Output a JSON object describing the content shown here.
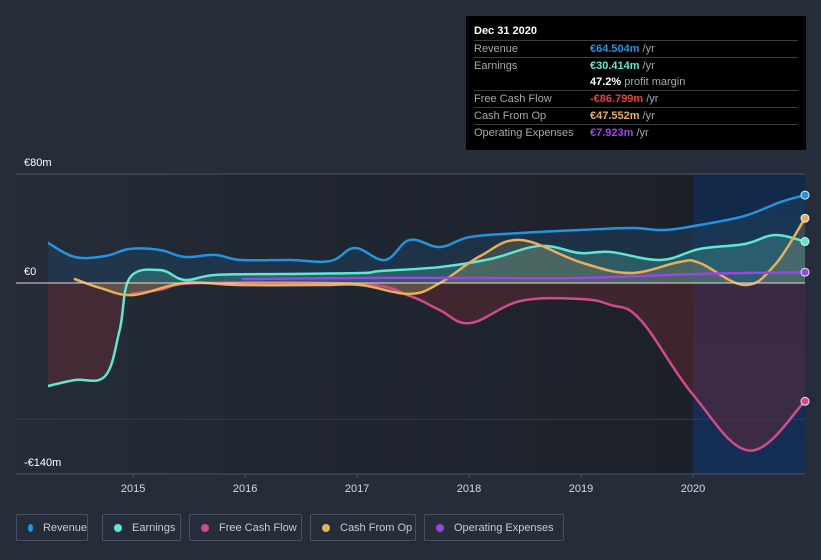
{
  "chart_data": {
    "type": "line",
    "title": "",
    "xlabel": "",
    "ylabel": "",
    "ylim": [
      -140,
      80
    ],
    "xlim": [
      2014.24,
      2021.0
    ],
    "y_ticks": [
      {
        "value": 80,
        "label": "€80m"
      },
      {
        "value": 0,
        "label": "€0"
      },
      {
        "value": -140,
        "label": "-€140m"
      }
    ],
    "y_gridlines": [
      80,
      0,
      -100
    ],
    "x_ticks": [
      {
        "value": 2015,
        "label": "2015"
      },
      {
        "value": 2016,
        "label": "2016"
      },
      {
        "value": 2017,
        "label": "2017"
      },
      {
        "value": 2018,
        "label": "2018"
      },
      {
        "value": 2019,
        "label": "2019"
      },
      {
        "value": 2020,
        "label": "2020"
      }
    ],
    "highlight_range": [
      2020.0,
      2021.0
    ],
    "legend_position": "bottom-left",
    "series": [
      {
        "name": "Revenue",
        "color": "#2394df",
        "fill": true,
        "x": [
          2014.24,
          2014.48,
          2014.75,
          2014.97,
          2015.24,
          2015.46,
          2015.73,
          2015.96,
          2016.4,
          2016.76,
          2016.98,
          2017.25,
          2017.47,
          2017.74,
          2018.01,
          2018.46,
          2018.99,
          2019.44,
          2019.75,
          2020.06,
          2020.46,
          2020.78,
          2021.0
        ],
        "values": [
          29.4,
          19.1,
          19.8,
          25.0,
          24.2,
          19.1,
          20.6,
          16.9,
          16.9,
          16.1,
          25.7,
          16.9,
          31.6,
          26.4,
          33.8,
          36.7,
          38.9,
          40.4,
          38.9,
          42.6,
          49.2,
          59.4,
          64.504
        ]
      },
      {
        "name": "Earnings",
        "color": "#5ee8d0",
        "fill": true,
        "x": [
          2014.24,
          2014.48,
          2014.75,
          2014.88,
          2014.97,
          2015.24,
          2015.46,
          2015.73,
          2016.31,
          2017.03,
          2017.21,
          2017.74,
          2018.19,
          2018.63,
          2018.99,
          2019.26,
          2019.71,
          2020.06,
          2020.46,
          2020.73,
          2021.0
        ],
        "values": [
          -75.6,
          -71.2,
          -68.3,
          -34.5,
          3.7,
          9.5,
          2.2,
          5.9,
          6.6,
          7.3,
          8.8,
          11.7,
          17.6,
          27.2,
          22.0,
          22.8,
          16.9,
          25.0,
          28.6,
          35.2,
          30.414
        ]
      },
      {
        "name": "Free Cash Flow",
        "color": "#d04b8e",
        "fill": true,
        "x": [
          2014.98,
          2015.24,
          2015.6,
          2017.03,
          2017.47,
          2017.74,
          2018.01,
          2018.46,
          2018.99,
          2019.26,
          2019.53,
          2020.0,
          2020.51,
          2021.0
        ],
        "values": [
          -8.0,
          -5.0,
          0.0,
          -0.7,
          -9.5,
          -20.0,
          -29.4,
          -13.2,
          -11.7,
          -16.0,
          -27.0,
          -82.0,
          -123.0,
          -86.799
        ]
      },
      {
        "name": "Cash From Op",
        "color": "#e8ae5a",
        "fill": true,
        "x": [
          2014.48,
          2014.71,
          2015.0,
          2015.46,
          2015.96,
          2016.67,
          2017.03,
          2017.47,
          2017.74,
          2018.1,
          2018.46,
          2018.99,
          2019.44,
          2019.88,
          2020.06,
          2020.46,
          2020.73,
          2021.0
        ],
        "values": [
          2.9,
          -3.7,
          -8.8,
          0.0,
          -1.5,
          -1.5,
          -1.5,
          -8.0,
          0.0,
          19.8,
          31.6,
          15.4,
          7.3,
          15.4,
          14.7,
          -1.5,
          13.2,
          47.552
        ]
      },
      {
        "name": "Operating Expenses",
        "color": "#9b45e4",
        "fill": false,
        "x": [
          2015.98,
          2017.03,
          2018.01,
          2018.99,
          2020.06,
          2021.0
        ],
        "values": [
          2.9,
          3.7,
          3.7,
          3.7,
          6.6,
          7.923
        ]
      }
    ]
  },
  "tooltip": {
    "title": "Dec 31 2020",
    "rows": [
      {
        "label": "Revenue",
        "value": "€64.504m",
        "unit": "/yr",
        "color": "#2394df"
      },
      {
        "label": "Earnings",
        "value": "€30.414m",
        "unit": "/yr",
        "color": "#5ee8d0"
      },
      {
        "label": "",
        "value": "47.2%",
        "unit": "profit margin",
        "color": "#ffffff"
      },
      {
        "label": "Free Cash Flow",
        "value": "-€86.799m",
        "unit": "/yr",
        "color": "#e64141"
      },
      {
        "label": "Cash From Op",
        "value": "€47.552m",
        "unit": "/yr",
        "color": "#e8ae5a"
      },
      {
        "label": "Operating Expenses",
        "value": "€7.923m",
        "unit": "/yr",
        "color": "#9b45e4"
      }
    ]
  },
  "legend": [
    {
      "label": "Revenue",
      "color": "#2394df"
    },
    {
      "label": "Earnings",
      "color": "#5ee8d0"
    },
    {
      "label": "Free Cash Flow",
      "color": "#d04b8e"
    },
    {
      "label": "Cash From Op",
      "color": "#e8ae5a"
    },
    {
      "label": "Operating Expenses",
      "color": "#9b45e4"
    }
  ]
}
